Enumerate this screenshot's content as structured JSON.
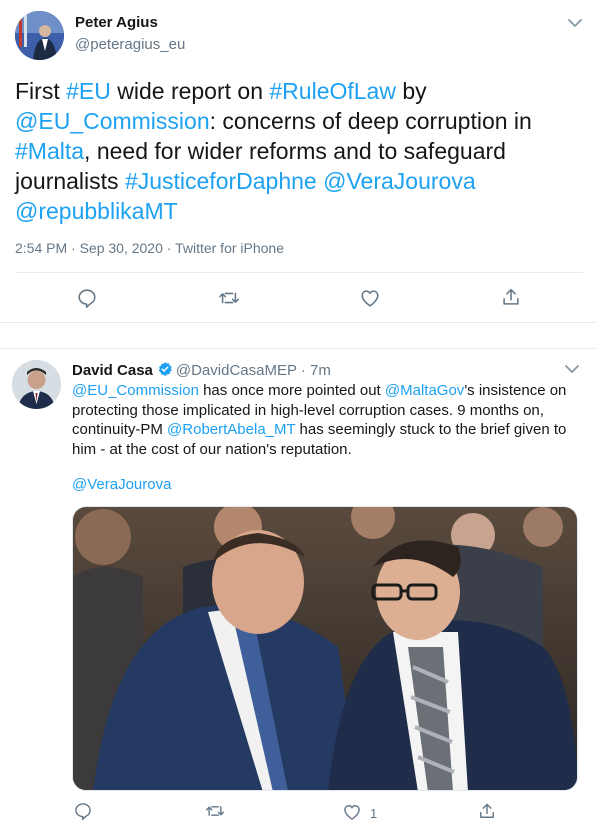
{
  "tweet_main": {
    "author_name": "Peter Agius",
    "author_handle": "@peteragius_eu",
    "text_parts": {
      "p1": "First ",
      "tag_eu": "#EU",
      "p2": " wide report on ",
      "tag_rol": "#RuleOfLaw",
      "p3": " by ",
      "mention_commission": "@EU_Commission",
      "p4": ": concerns of deep corruption in ",
      "tag_malta": "#Malta",
      "p5": ", need for wider reforms and to safeguard journalists ",
      "tag_daphne": "#JusticeforDaphne",
      "p6": " ",
      "mention_jourova": "@VeraJourova",
      "p7": " ",
      "mention_repubblika": "@repubblikaMT"
    },
    "timestamp": "2:54 PM · Sep 30, 2020 · Twitter for iPhone"
  },
  "tweet_reply": {
    "author_name": "David Casa",
    "author_handle": "@DavidCasaMEP",
    "time_ago": "· 7m",
    "text_parts": {
      "mention_commission": "@EU_Commission",
      "p1": " has once more pointed out ",
      "mention_maltagov": "@MaltaGov",
      "p2": "'s insistence on protecting those implicated in high-level corruption cases. 9 months on, continuity-PM ",
      "mention_abela": "@RobertAbela_MT",
      "p3": " has seemingly stuck to the brief given to him - at the cost of our nation's reputation."
    },
    "mention_line": "@VeraJourova",
    "like_count": "1"
  },
  "icons": {
    "reply": "reply-icon",
    "retweet": "retweet-icon",
    "like": "heart-icon",
    "share": "share-icon",
    "more": "chevron-down-icon",
    "verified": "verified-badge-icon"
  },
  "colors": {
    "link": "#1da1f2",
    "secondary_text": "#657786",
    "primary_text": "#14171a",
    "divider": "#e6ecf0"
  }
}
